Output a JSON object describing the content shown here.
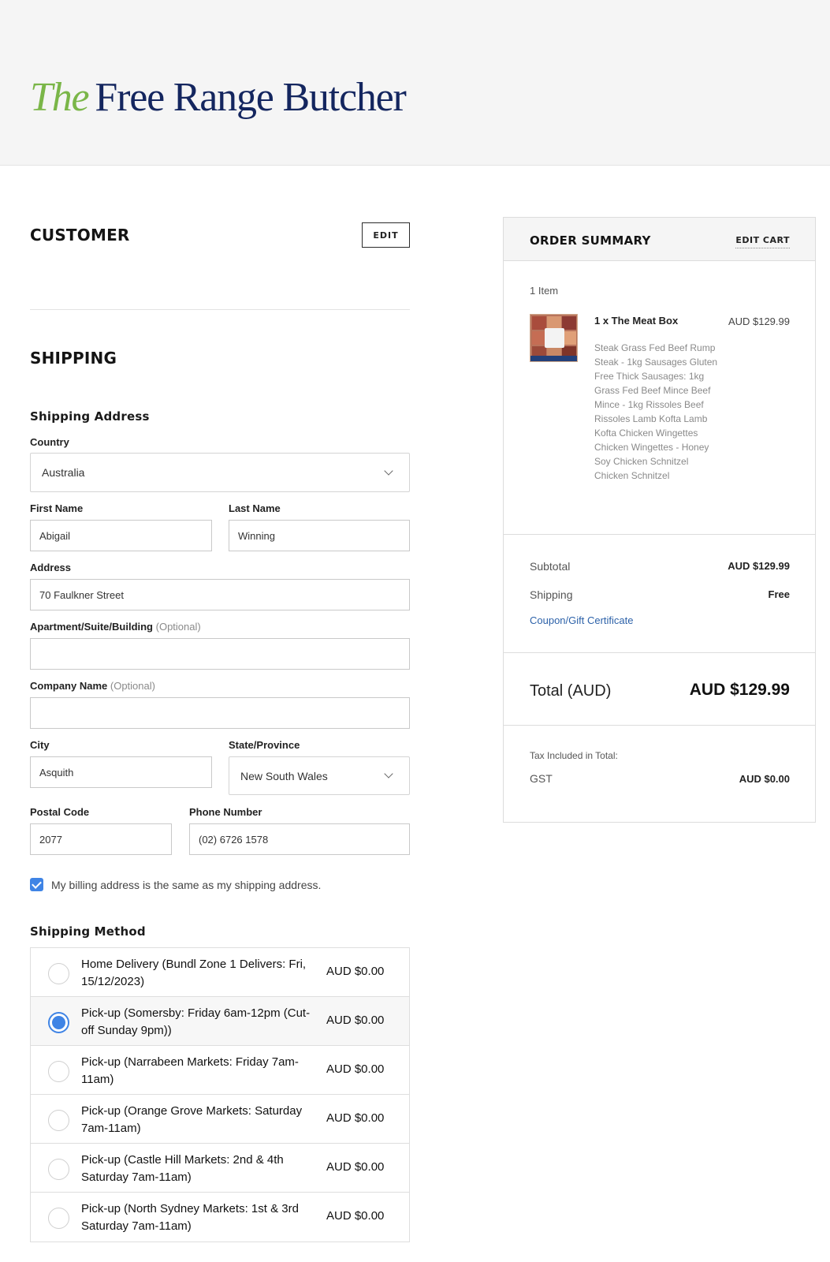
{
  "logo": {
    "the": "The",
    "rest": "Free Range Butcher"
  },
  "customer": {
    "title": "CUSTOMER",
    "edit_label": "EDIT"
  },
  "shipping": {
    "title": "SHIPPING",
    "address_heading": "Shipping Address",
    "country": {
      "label": "Country",
      "value": "Australia"
    },
    "first_name": {
      "label": "First Name",
      "value": "Abigail"
    },
    "last_name": {
      "label": "Last Name",
      "value": "Winning"
    },
    "address": {
      "label": "Address",
      "value": "70 Faulkner Street"
    },
    "apartment": {
      "label": "Apartment/Suite/Building",
      "optional": "(Optional)",
      "value": ""
    },
    "company": {
      "label": "Company Name",
      "optional": "(Optional)",
      "value": ""
    },
    "city": {
      "label": "City",
      "value": "Asquith"
    },
    "state": {
      "label": "State/Province",
      "value": "New South Wales"
    },
    "postal": {
      "label": "Postal Code",
      "value": "2077"
    },
    "phone": {
      "label": "Phone Number",
      "value": "(02) 6726 1578"
    },
    "billing_same": {
      "label": "My billing address is the same as my shipping address.",
      "checked": true
    },
    "method_heading": "Shipping Method",
    "methods": [
      {
        "label": "Home Delivery (Bundl Zone 1 Delivers: Fri, 15/12/2023)",
        "price": "AUD $0.00",
        "selected": false
      },
      {
        "label": "Pick-up (Somersby: Friday 6am-12pm (Cut-off Sunday 9pm))",
        "price": "AUD $0.00",
        "selected": true
      },
      {
        "label": "Pick-up (Narrabeen Markets: Friday 7am-11am)",
        "price": "AUD $0.00",
        "selected": false
      },
      {
        "label": "Pick-up (Orange Grove Markets: Saturday 7am-11am)",
        "price": "AUD $0.00",
        "selected": false
      },
      {
        "label": "Pick-up (Castle Hill Markets: 2nd & 4th Saturday 7am-11am)",
        "price": "AUD $0.00",
        "selected": false
      },
      {
        "label": "Pick-up (North Sydney Markets: 1st & 3rd Saturday 7am-11am)",
        "price": "AUD $0.00",
        "selected": false
      }
    ]
  },
  "summary": {
    "title": "ORDER SUMMARY",
    "edit_cart": "EDIT CART",
    "item_count": "1 Item",
    "item": {
      "name": "1 x The Meat Box",
      "price": "AUD $129.99",
      "options": "Steak Grass Fed Beef Rump Steak - 1kg Sausages Gluten Free Thick Sausages: 1kg Grass Fed Beef Mince Beef Mince - 1kg Rissoles Beef Rissoles Lamb Kofta Lamb Kofta Chicken Wingettes Chicken Wingettes - Honey Soy Chicken Schnitzel Chicken Schnitzel"
    },
    "subtotal_label": "Subtotal",
    "subtotal_value": "AUD $129.99",
    "shipping_label": "Shipping",
    "shipping_value": "Free",
    "coupon_label": "Coupon/Gift Certificate",
    "total_label": "Total (AUD)",
    "total_value": "AUD $129.99",
    "tax_label": "Tax Included in Total:",
    "gst_label": "GST",
    "gst_value": "AUD $0.00"
  },
  "colors": {
    "accent": "#3f84e5",
    "logo_green": "#7ab648",
    "logo_navy": "#14265f",
    "link": "#2d62a9"
  }
}
